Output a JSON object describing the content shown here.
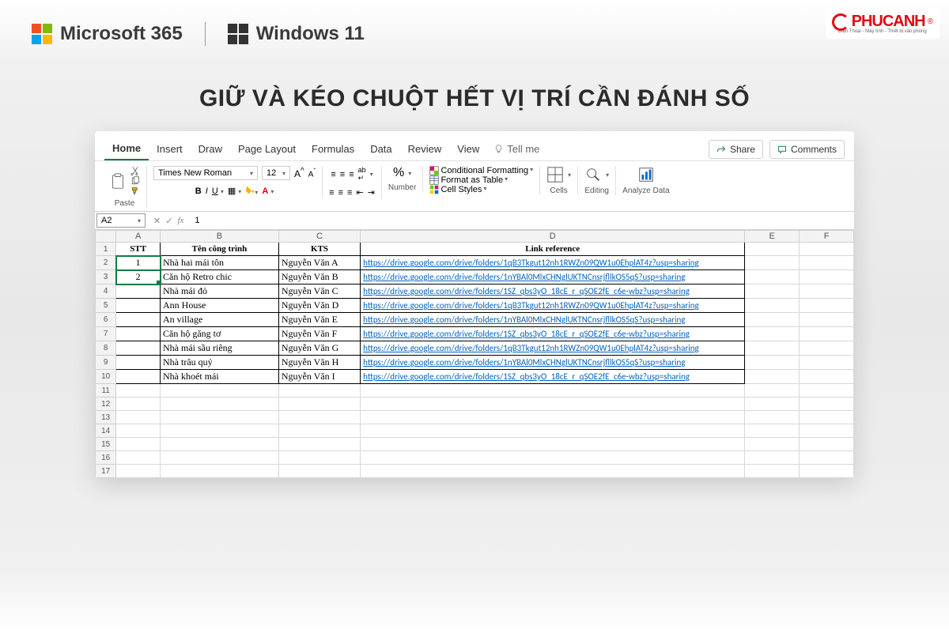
{
  "header": {
    "ms365": "Microsoft 365",
    "win11": "Windows 11",
    "phucanh": "PHUCANH",
    "phucanh_sub": "Điện Thoại - Máy tính - Thiết bị văn phòng"
  },
  "caption": "GIỮ VÀ KÉO CHUỘT HẾT VỊ TRÍ CẦN ĐÁNH SỐ",
  "tabs": [
    "Home",
    "Insert",
    "Draw",
    "Page Layout",
    "Formulas",
    "Data",
    "Review",
    "View"
  ],
  "tellme": "Tell me",
  "share": "Share",
  "comments": "Comments",
  "ribbon": {
    "paste": "Paste",
    "font_name": "Times New Roman",
    "font_size": "12",
    "number": "Number",
    "cond_fmt": "Conditional Formatting",
    "fmt_table": "Format as Table",
    "cell_styles": "Cell Styles",
    "cells": "Cells",
    "editing": "Editing",
    "analyze": "Analyze Data",
    "percent": "%"
  },
  "formulabar": {
    "cell": "A2",
    "value": "1"
  },
  "columns": [
    "A",
    "B",
    "C",
    "D",
    "E",
    "F"
  ],
  "table": {
    "headers": {
      "stt": "STT",
      "ten": "Tên công trình",
      "kts": "KTS",
      "link": "Link reference"
    },
    "rows": [
      {
        "stt": "1",
        "ten": "Nhà hai mái tôn",
        "kts": "Nguyễn Văn A",
        "link": "https://drive.google.com/drive/folders/1qB3Tkgut12nh1RWZn09QW1u0EhplAT4z?usp=sharing"
      },
      {
        "stt": "2",
        "ten": "Căn hộ Retro chic",
        "kts": "Nguyễn Văn B",
        "link": "https://drive.google.com/drive/folders/1nYBAl0MlxCHNglUKTNCnsrjfllkOS5qS?usp=sharing"
      },
      {
        "stt": "",
        "ten": "Nhà mái đỏ",
        "kts": "Nguyễn Văn C",
        "link": "https://drive.google.com/drive/folders/1SZ_qbs3yO_18cE_r_qSOE2fE_c6e-wbz?usp=sharing"
      },
      {
        "stt": "",
        "ten": "Ann House",
        "kts": "Nguyễn Văn D",
        "link": "https://drive.google.com/drive/folders/1qB3Tkgut12nh1RWZn09QW1u0EhplAT4z?usp=sharing"
      },
      {
        "stt": "",
        "ten": "An village",
        "kts": "Nguyễn Văn E",
        "link": "https://drive.google.com/drive/folders/1nYBAl0MlxCHNglUKTNCnsrjfllkOS5qS?usp=sharing"
      },
      {
        "stt": "",
        "ten": "Căn hộ găng tơ",
        "kts": "Nguyễn Văn F",
        "link": "https://drive.google.com/drive/folders/1SZ_qbs3yO_18cE_r_qSOE2fE_c6e-wbz?usp=sharing"
      },
      {
        "stt": "",
        "ten": "Nhà mái sầu riêng",
        "kts": "Nguyễn Văn G",
        "link": "https://drive.google.com/drive/folders/1qB3Tkgut12nh1RWZn09QW1u0EhplAT4z?usp=sharing"
      },
      {
        "stt": "",
        "ten": "Nhà trâu quỷ",
        "kts": "Nguyễn Văn H",
        "link": "https://drive.google.com/drive/folders/1nYBAl0MlxCHNglUKTNCnsrjfllkOS5qS?usp=sharing"
      },
      {
        "stt": "",
        "ten": "Nhà khoét mái",
        "kts": "Nguyễn Văn I",
        "link": "https://drive.google.com/drive/folders/1SZ_qbs3yO_18cE_r_qSOE2fE_c6e-wbz?usp=sharing"
      }
    ]
  },
  "extra_rows": [
    11,
    12,
    13,
    14,
    15,
    16,
    17
  ]
}
